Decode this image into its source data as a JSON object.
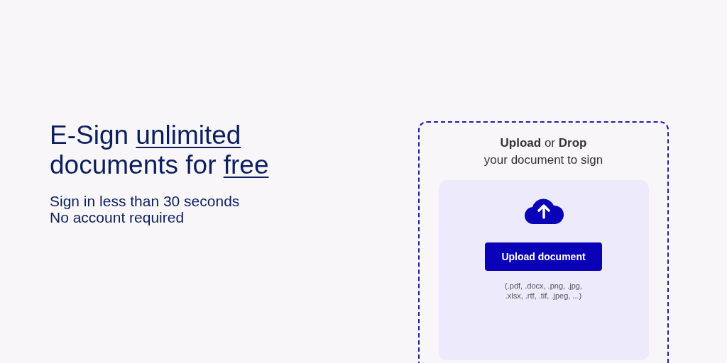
{
  "headline": {
    "lines": [
      [
        {
          "text": "E-Sign ",
          "underlined": false
        },
        {
          "text": "unlimited",
          "underlined": true
        }
      ],
      [
        {
          "text": "documents for ",
          "underlined": false
        },
        {
          "text": "free",
          "underlined": true
        }
      ]
    ]
  },
  "subtitle_lines": [
    "Sign in less than 30 seconds",
    "No account required"
  ],
  "upload": {
    "prompt": "**Upload** or **Drop**",
    "prompt_line_2": "your document to sign",
    "button": "Upload document",
    "formats": [
      "(.pdf, .docx, .png, .jpg,",
      ".xlsx, .rtf, .tif, .jpeg, ...)"
    ]
  }
}
